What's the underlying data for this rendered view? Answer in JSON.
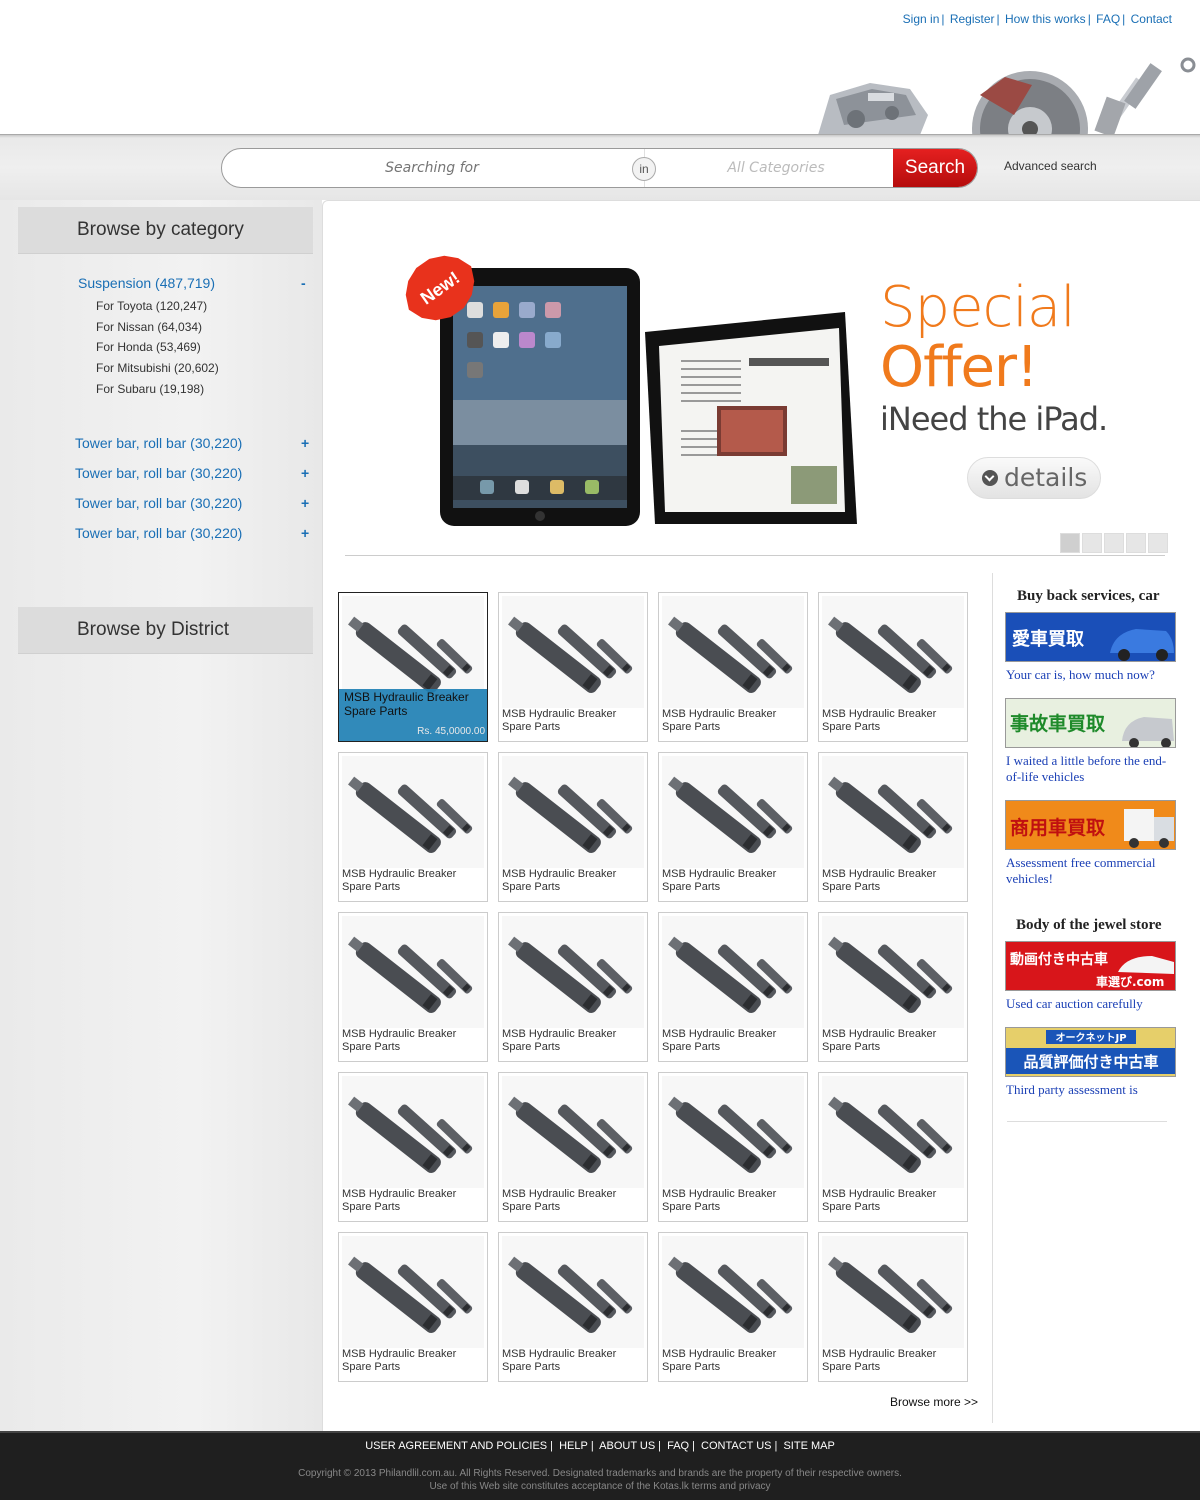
{
  "header": {
    "links": [
      "Sign in",
      "Register",
      "How this works",
      "FAQ",
      "Contact"
    ]
  },
  "search": {
    "placeholder": "Searching for",
    "in_label": "in",
    "category_value": "All Categories",
    "button_label": "Search",
    "advanced_label": "Advanced search"
  },
  "sidebar": {
    "category_heading": "Browse by category",
    "main_category": "Suspension (487,719)",
    "main_toggle": "-",
    "subcategories": [
      "For Toyota (120,247)",
      "For Nissan (64,034)",
      "For Honda (53,469)",
      "For Mitsubishi (20,602)",
      "For Subaru (19,198)"
    ],
    "other_categories": [
      "Tower bar, roll bar (30,220)",
      "Tower bar, roll bar (30,220)",
      "Tower bar, roll bar (30,220)",
      "Tower bar, roll bar (30,220)"
    ],
    "other_toggle": "+",
    "district_heading": "Browse by District"
  },
  "banner": {
    "badge": "New!",
    "line1": "Special",
    "line2": "Offer!",
    "line3": "iNeed the iPad.",
    "details_label": "details",
    "slides": 5,
    "active_slide": 1
  },
  "products": {
    "featured_name": "MSB Hydraulic Breaker Spare Parts",
    "featured_price": "Rs. 45,0000.00",
    "items": [
      "MSB Hydraulic Breaker Spare Parts",
      "MSB Hydraulic Breaker Spare Parts",
      "MSB Hydraulic Breaker Spare Parts",
      "MSB Hydraulic Breaker Spare Parts",
      "MSB Hydraulic Breaker Spare Parts",
      "MSB Hydraulic Breaker Spare Parts",
      "MSB Hydraulic Breaker Spare Parts",
      "MSB Hydraulic Breaker Spare Parts",
      "MSB Hydraulic Breaker Spare Parts",
      "MSB Hydraulic Breaker Spare Parts",
      "MSB Hydraulic Breaker Spare Parts",
      "MSB Hydraulic Breaker Spare Parts",
      "MSB Hydraulic Breaker Spare Parts",
      "MSB Hydraulic Breaker Spare Parts",
      "MSB Hydraulic Breaker Spare Parts",
      "MSB Hydraulic Breaker Spare Parts",
      "MSB Hydraulic Breaker Spare Parts",
      "MSB Hydraulic Breaker Spare Parts",
      "MSB Hydraulic Breaker Spare Parts",
      "MSB Hydraulic Breaker Spare Parts"
    ],
    "browse_more": "Browse more >>"
  },
  "right_panel": {
    "section1_title": "Buy back services, car",
    "ads1": [
      {
        "text": "愛車買取",
        "bg": "#1a4fb8",
        "link": "Your car is, how much now?"
      },
      {
        "text": "事故車買取",
        "bg": "#1e8a2a",
        "link": "I waited a little before the end-of-life vehicles"
      },
      {
        "text": "商用車買取",
        "bg": "#f08a1a",
        "link": "Assessment free commercial vehicles!"
      }
    ],
    "section2_title": "Body of the jewel store",
    "ads2": [
      {
        "text": "動画付き中古車",
        "sub": "車選び.com",
        "bg": "#d8151a",
        "link": "Used car auction carefully"
      },
      {
        "text": "品質評価付き中古車",
        "sub": "オークネットJP",
        "bg": "#e6cf6a",
        "link": "Third party assessment is"
      }
    ]
  },
  "footer": {
    "links": [
      "USER AGREEMENT AND POLICIES",
      "HELP",
      "ABOUT US",
      "FAQ",
      "CONTACT US",
      "SITE MAP"
    ],
    "copyright_line1": "Copyright © 2013 Philandlil.com.au. All Rights Reserved. Designated trademarks and brands are the property of their respective owners.",
    "copyright_line2": "Use of this Web site constitutes acceptance of the Kotas.lk terms and privacy"
  },
  "colors": {
    "link_blue": "#1a6fb5",
    "search_red": "#d41515",
    "offer_orange": "#f07a1c",
    "featured_overlay": "#1f80b4"
  }
}
